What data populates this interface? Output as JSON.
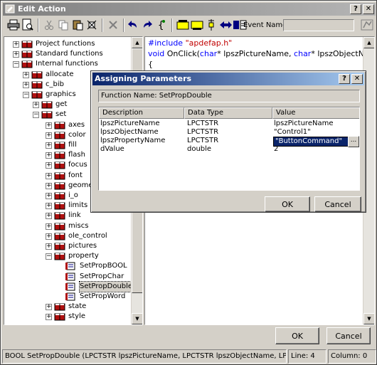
{
  "window": {
    "title": "Edit Action",
    "help_button": "?",
    "close_button": "✕"
  },
  "toolbar": {
    "icons": [
      "printer-icon",
      "print-preview-icon",
      "cut-icon",
      "copy-icon",
      "paste-icon",
      "format-icon",
      "delete-icon",
      "undo-icon",
      "redo-icon",
      "brace-icon",
      "toolbar-icon-a",
      "toolbar-icon-b",
      "toolbar-icon-c",
      "toolbar-icon-d",
      "toolbar-icon-e"
    ],
    "event_name_label": "Event Name:",
    "event_name_value": ""
  },
  "tree": {
    "items": [
      {
        "label": "Project functions",
        "level": 0,
        "expander": "+"
      },
      {
        "label": "Standard functions",
        "level": 0,
        "expander": "+"
      },
      {
        "label": "Internal functions",
        "level": 0,
        "expander": "−"
      },
      {
        "label": "allocate",
        "level": 1,
        "expander": "+"
      },
      {
        "label": "c_bib",
        "level": 1,
        "expander": "+"
      },
      {
        "label": "graphics",
        "level": 1,
        "expander": "−"
      },
      {
        "label": "get",
        "level": 2,
        "expander": "+"
      },
      {
        "label": "set",
        "level": 2,
        "expander": "−"
      },
      {
        "label": "axes",
        "level": 3,
        "expander": "+"
      },
      {
        "label": "color",
        "level": 3,
        "expander": "+"
      },
      {
        "label": "fill",
        "level": 3,
        "expander": "+"
      },
      {
        "label": "flash",
        "level": 3,
        "expander": "+"
      },
      {
        "label": "focus",
        "level": 3,
        "expander": "+"
      },
      {
        "label": "font",
        "level": 3,
        "expander": "+"
      },
      {
        "label": "geome",
        "level": 3,
        "expander": "+"
      },
      {
        "label": "i_o",
        "level": 3,
        "expander": "+"
      },
      {
        "label": "limits",
        "level": 3,
        "expander": "+"
      },
      {
        "label": "link",
        "level": 3,
        "expander": "+"
      },
      {
        "label": "miscs",
        "level": 3,
        "expander": "+"
      },
      {
        "label": "ole_control",
        "level": 3,
        "expander": "+"
      },
      {
        "label": "pictures",
        "level": 3,
        "expander": "+"
      },
      {
        "label": "property",
        "level": 3,
        "expander": "−"
      },
      {
        "label": "SetPropBOOL",
        "level": 4,
        "expander": ""
      },
      {
        "label": "SetPropChar",
        "level": 4,
        "expander": ""
      },
      {
        "label": "SetPropDouble",
        "level": 4,
        "expander": "",
        "selected": true
      },
      {
        "label": "SetPropWord",
        "level": 4,
        "expander": ""
      },
      {
        "label": "state",
        "level": 3,
        "expander": "+"
      },
      {
        "label": "style",
        "level": 3,
        "expander": "+"
      }
    ]
  },
  "code": {
    "line1_directive": "#include",
    "line1_string": "\"apdefap.h\"",
    "line2_kw1": "void",
    "line2_fn": " OnClick(",
    "line2_kw2": "char",
    "line2_p1": "* lpszPictureName, ",
    "line2_kw3": "char",
    "line2_p2": "* lpszObjectName",
    "line3": "{"
  },
  "buttons": {
    "ok": "OK",
    "cancel": "Cancel"
  },
  "dialog": {
    "title": "Assigning Parameters",
    "help_button": "?",
    "close_button": "✕",
    "function_name": "Function Name: SetPropDouble",
    "columns": [
      "Description",
      "Data Type",
      "Value"
    ],
    "rows": [
      {
        "description": "lpszPictureName",
        "type": "LPCTSTR",
        "value": "lpszPictureName"
      },
      {
        "description": "lpszObjectName",
        "type": "LPCTSTR",
        "value": "\"Control1\""
      },
      {
        "description": "lpszPropertyName",
        "type": "LPCTSTR",
        "value": "\"ButtonCommand\""
      },
      {
        "description": "dValue",
        "type": "double",
        "value": "2"
      }
    ],
    "browse_button": "...",
    "ok": "OK",
    "cancel": "Cancel"
  },
  "status": {
    "signature": "BOOL SetPropDouble (LPCTSTR lpszPictureName, LPCTSTR lpszObjectName, LPCTSTR lpszPro",
    "line": "Line: 4",
    "column": "Column: 0"
  },
  "colors": {
    "keyword": "#0000ff",
    "string": "#c00000",
    "directive": "#0000ff",
    "selection": "#0a246a",
    "book_red": "#b01010"
  }
}
